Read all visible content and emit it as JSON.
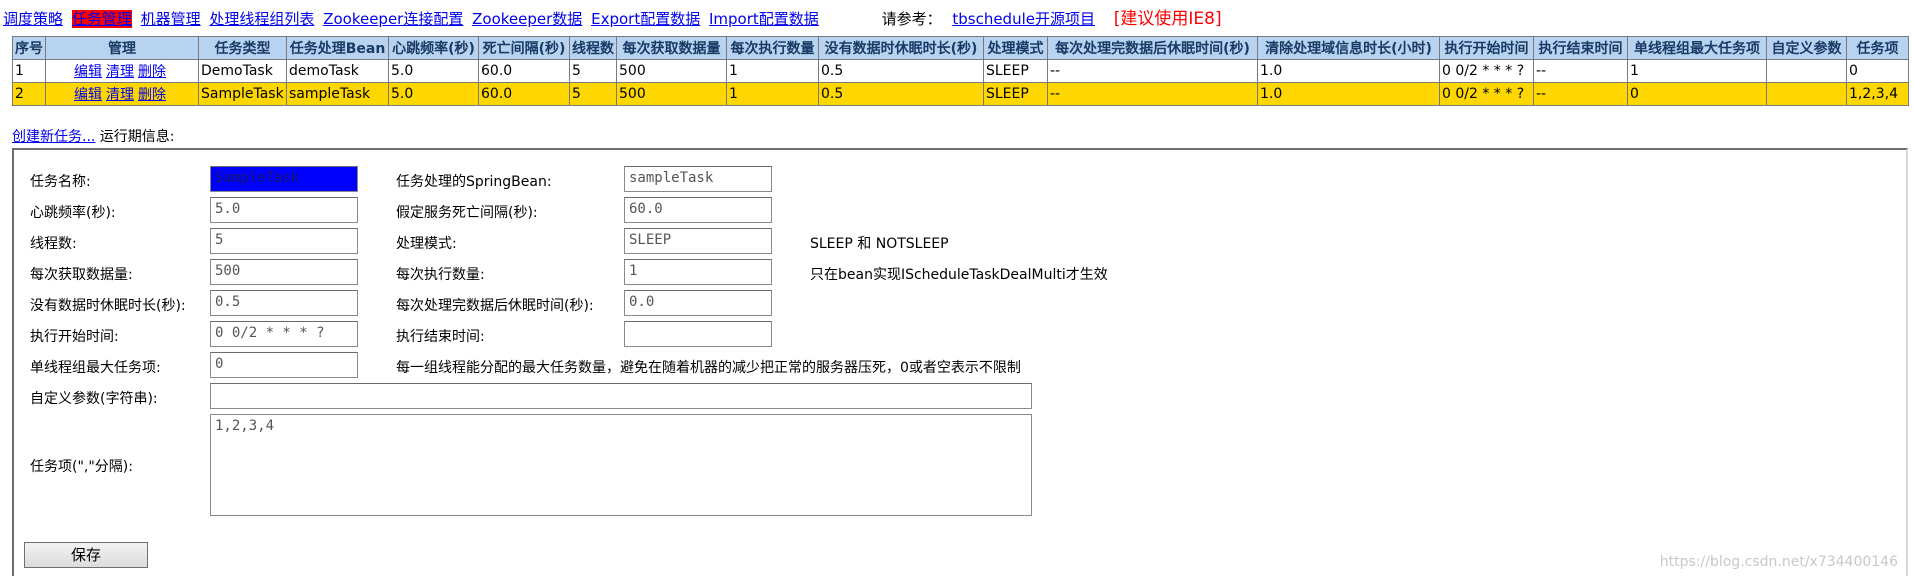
{
  "nav": {
    "items": [
      "调度策略",
      "任务管理",
      "机器管理",
      "处理线程组列表",
      "Zookeeper连接配置",
      "Zookeeper数据",
      "Export配置数据",
      "Import配置数据"
    ],
    "ref_label": "请参考：",
    "ref_link": "tbschedule开源项目",
    "warning": "[建议使用IE8]"
  },
  "table": {
    "headers": [
      "序号",
      "管理",
      "任务类型",
      "任务处理Bean",
      "心跳频率(秒)",
      "死亡间隔(秒)",
      "线程数",
      "每次获取数据量",
      "每次执行数量",
      "没有数据时休眠时长(秒)",
      "处理模式",
      "每次处理完数据后休眠时间(秒)",
      "清除处理域信息时长(小时)",
      "执行开始时间",
      "执行结束时间",
      "单线程组最大任务项",
      "自定义参数",
      "任务项"
    ],
    "actions": [
      "编辑",
      "清理",
      "删除"
    ],
    "rows": [
      [
        "1",
        "DemoTask",
        "demoTask",
        "5.0",
        "60.0",
        "5",
        "500",
        "1",
        "0.5",
        "SLEEP",
        "--",
        "1.0",
        "0 0/2 * * * ?",
        "--",
        "1",
        "",
        "0"
      ],
      [
        "2",
        "SampleTask",
        "sampleTask",
        "5.0",
        "60.0",
        "5",
        "500",
        "1",
        "0.5",
        "SLEEP",
        "--",
        "1.0",
        "0 0/2 * * * ?",
        "--",
        "0",
        "",
        "1,2,3,4"
      ]
    ]
  },
  "links": {
    "create": "创建新任务...",
    "runtime": " 运行期信息:"
  },
  "form": {
    "task_name_label": "任务名称:",
    "task_name": "SampleTask",
    "bean_label": "任务处理的SpringBean:",
    "bean": "sampleTask",
    "heartbeat_label": "心跳频率(秒):",
    "heartbeat": "5.0",
    "dead_label": "假定服务死亡间隔(秒):",
    "dead": "60.0",
    "threads_label": "线程数:",
    "threads": "5",
    "mode_label": "处理模式:",
    "mode": "SLEEP",
    "mode_hint": "SLEEP 和 NOTSLEEP",
    "fetch_label": "每次获取数据量:",
    "fetch": "500",
    "exec_label": "每次执行数量:",
    "exec": "1",
    "exec_hint": "只在bean实现IScheduleTaskDealMulti才生效",
    "nodata_sleep_label": "没有数据时休眠时长(秒):",
    "nodata_sleep": "0.5",
    "after_sleep_label": "每次处理完数据后休眠时间(秒):",
    "after_sleep": "0.0",
    "start_label": "执行开始时间:",
    "start": "0 0/2 * * * ?",
    "end_label": "执行结束时间:",
    "end": "",
    "max_items_label": "单线程组最大任务项:",
    "max_items": "0",
    "max_items_hint": "每一组线程能分配的最大任务数量，避免在随着机器的减少把正常的服务器压死，0或者空表示不限制",
    "params_label": "自定义参数(字符串):",
    "params": "",
    "items_label": "任务项(\",\"分隔):",
    "items": "1,2,3,4",
    "save": "保存"
  },
  "watermark": "https://blog.csdn.net/x734400146"
}
